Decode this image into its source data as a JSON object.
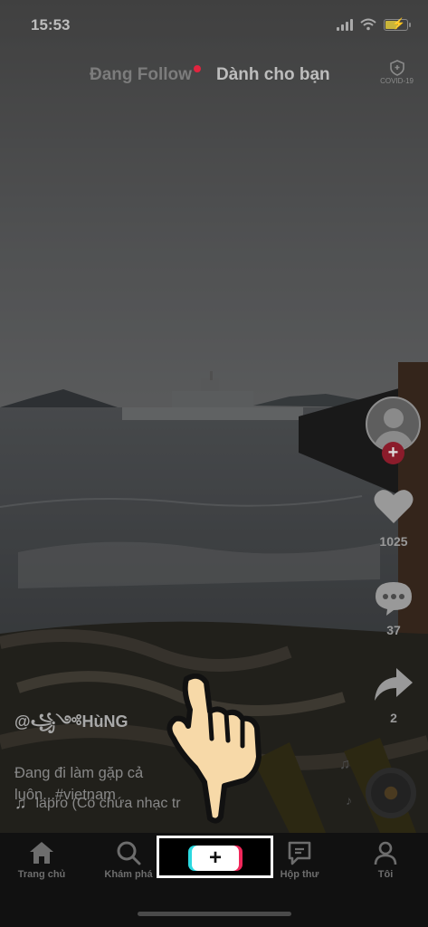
{
  "status_bar": {
    "time": "15:53",
    "signal_icon": "signal-bars-icon",
    "wifi_icon": "wifi-icon",
    "battery_icon": "battery-charging-icon"
  },
  "top_tabs": {
    "following": "Đang Follow",
    "for_you": "Dành cho bạn",
    "covid_label": "COVID-19"
  },
  "actions": {
    "like_count": "1025",
    "comment_count": "37",
    "share_count": "2"
  },
  "caption": {
    "username": "@꧁༺HùNG",
    "description": "Đang đi làm gặp cả\nluôn...#vietnam",
    "music": "lapro (Có chứa nhạc tr"
  },
  "bottom_nav": {
    "home": "Trang chủ",
    "discover": "Khám phá",
    "create_icon": "plus-icon",
    "inbox": "Hộp thư",
    "profile": "Tôi"
  },
  "colors": {
    "red_accent": "#e1243f",
    "tiktok_cyan": "#2bd9e0",
    "tiktok_pink": "#f0275a",
    "nav_background": "#111111",
    "hand_skin": "#f7d9a8"
  }
}
